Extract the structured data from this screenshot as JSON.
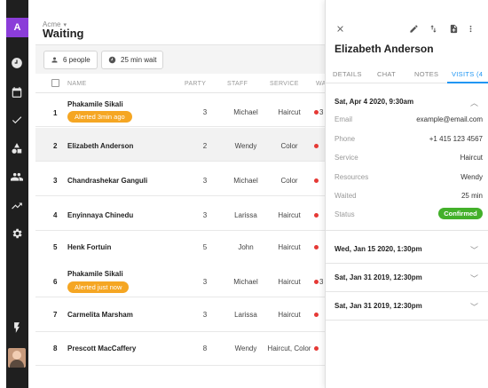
{
  "rail": {
    "logo_letter": "A",
    "icons": [
      "clock-icon",
      "calendar-icon",
      "check-icon",
      "shapes-icon",
      "people-icon",
      "trending-icon",
      "settings-icon",
      "bolt-icon"
    ]
  },
  "header": {
    "breadcrumb": "Acme",
    "title": "Waiting"
  },
  "filters": {
    "party_chip": "6 people",
    "wait_chip": "25 min wait"
  },
  "table": {
    "columns": {
      "name": "NAME",
      "party": "PARTY",
      "staff": "STAFF",
      "service": "SERVICE",
      "wait": "WA"
    },
    "rows": [
      {
        "num": "1",
        "name": "Phakamile Sikali",
        "party": "3",
        "staff": "Michael",
        "service": "Haircut",
        "badge": "Alerted 3min ago",
        "dot_text": "3"
      },
      {
        "num": "2",
        "name": "Elizabeth Anderson",
        "party": "2",
        "staff": "Wendy",
        "service": "Color",
        "badge": "",
        "dot_text": ""
      },
      {
        "num": "3",
        "name": "Chandrashekar Ganguli",
        "party": "3",
        "staff": "Michael",
        "service": "Color",
        "badge": "",
        "dot_text": ""
      },
      {
        "num": "4",
        "name": "Enyinnaya Chinedu",
        "party": "3",
        "staff": "Larissa",
        "service": "Haircut",
        "badge": "",
        "dot_text": ""
      },
      {
        "num": "5",
        "name": "Henk Fortuin",
        "party": "5",
        "staff": "John",
        "service": "Haircut",
        "badge": "",
        "dot_text": ""
      },
      {
        "num": "6",
        "name": "Phakamile Sikali",
        "party": "3",
        "staff": "Michael",
        "service": "Haircut",
        "badge": "Alerted just now",
        "dot_text": "3"
      },
      {
        "num": "7",
        "name": "Carmelita Marsham",
        "party": "3",
        "staff": "Larissa",
        "service": "Haircut",
        "badge": "",
        "dot_text": ""
      },
      {
        "num": "8",
        "name": "Prescott MacCaffery",
        "party": "8",
        "staff": "Wendy",
        "service": "Haircut, Color",
        "badge": "",
        "dot_text": ""
      }
    ]
  },
  "panel": {
    "customer_name": "Elizabeth Anderson",
    "tabs": [
      "DETAILS",
      "CHAT",
      "NOTES",
      "VISITS (4"
    ],
    "active_tab": "VISITS (4",
    "expanded_visit": {
      "date": "Sat, Apr 4 2020, 9:30am",
      "fields": [
        {
          "label": "Email",
          "value": "example@email.com"
        },
        {
          "label": "Phone",
          "value": "+1 415 123 4567"
        },
        {
          "label": "Service",
          "value": "Haircut"
        },
        {
          "label": "Resources",
          "value": "Wendy"
        },
        {
          "label": "Waited",
          "value": "25 min"
        }
      ],
      "status_label": "Status",
      "status": "Confirmed"
    },
    "other_visits": [
      "Wed, Jan 15 2020, 1:30pm",
      "Sat, Jan 31 2019, 12:30pm",
      "Sat, Jan 31 2019, 12:30pm"
    ]
  },
  "colors": {
    "accent": "#2196f3",
    "alert_badge": "#f5a623",
    "confirmed": "#43b02a",
    "logo": "#8b3dd9",
    "wait_dot": "#e53935"
  }
}
